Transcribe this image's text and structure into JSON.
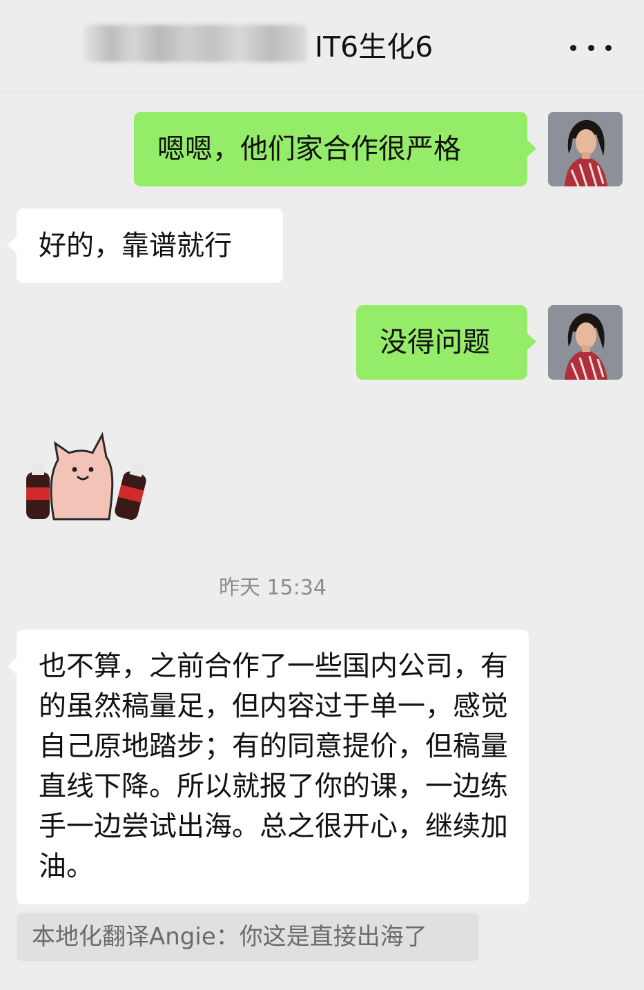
{
  "header": {
    "title": "IT6生化6",
    "more_icon": "more-dots-icon"
  },
  "messages": [
    {
      "side": "me",
      "text": "嗯嗯，他们家合作很严格"
    },
    {
      "side": "other",
      "text": "好的，靠谱就行"
    },
    {
      "side": "me",
      "text": "没得问题"
    },
    {
      "side": "other",
      "type": "sticker",
      "sticker": "pig-with-cola-sticker"
    },
    {
      "side": "other",
      "text": "也不算，之前合作了一些国内公司，有的虽然稿量足，但内容过于单一，感觉自己原地踏步；有的同意提价，但稿量直线下降。所以就报了你的课，一边练手一边尝试出海。总之很开心，继续加油。"
    }
  ],
  "timestamp": "昨天 15:34",
  "quote": {
    "text": "本地化翻译Angie：你这是直接出海了"
  },
  "colors": {
    "background": "#ededed",
    "me_bubble": "#95ec69",
    "other_bubble": "#ffffff",
    "quote_bg": "#e0e0e0"
  }
}
